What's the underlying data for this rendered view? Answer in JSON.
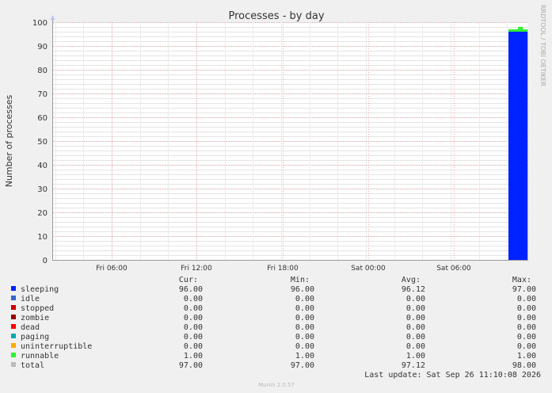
{
  "chart_data": {
    "type": "area",
    "title": "Processes - by day",
    "ylabel": "Number of processes",
    "xlabel": "",
    "ylim": [
      0,
      100
    ],
    "yticks": [
      0,
      10,
      20,
      30,
      40,
      50,
      60,
      70,
      80,
      90,
      100
    ],
    "x_tick_labels": [
      "Fri 06:00",
      "Fri 12:00",
      "Fri 18:00",
      "Sat 00:00",
      "Sat 06:00"
    ],
    "grid": true,
    "stacked": true,
    "series": [
      {
        "name": "sleeping",
        "color": "#0022ff",
        "values": [
          96,
          96,
          96,
          96
        ]
      },
      {
        "name": "idle",
        "color": "#3366cc",
        "values": [
          0,
          0,
          0,
          0
        ]
      },
      {
        "name": "stopped",
        "color": "#cc0000",
        "values": [
          0,
          0,
          0,
          0
        ]
      },
      {
        "name": "zombie",
        "color": "#990000",
        "values": [
          0,
          0,
          0,
          0
        ]
      },
      {
        "name": "dead",
        "color": "#ff0000",
        "values": [
          0,
          0,
          0,
          0
        ]
      },
      {
        "name": "paging",
        "color": "#00aaaa",
        "values": [
          0,
          0,
          0,
          0
        ]
      },
      {
        "name": "uninterruptible",
        "color": "#ffaa00",
        "values": [
          0,
          0,
          0,
          0
        ]
      },
      {
        "name": "runnable",
        "color": "#33ee33",
        "values": [
          1,
          1,
          2,
          1
        ]
      }
    ]
  },
  "legend": {
    "headers": [
      "Cur:",
      "Min:",
      "Avg:",
      "Max:"
    ],
    "rows": [
      {
        "name": "sleeping",
        "color": "#0022ff",
        "cur": "96.00",
        "min": "96.00",
        "avg": "96.12",
        "max": "97.00"
      },
      {
        "name": "idle",
        "color": "#3366cc",
        "cur": "0.00",
        "min": "0.00",
        "avg": "0.00",
        "max": "0.00"
      },
      {
        "name": "stopped",
        "color": "#cc0000",
        "cur": "0.00",
        "min": "0.00",
        "avg": "0.00",
        "max": "0.00"
      },
      {
        "name": "zombie",
        "color": "#990000",
        "cur": "0.00",
        "min": "0.00",
        "avg": "0.00",
        "max": "0.00"
      },
      {
        "name": "dead",
        "color": "#ff0000",
        "cur": "0.00",
        "min": "0.00",
        "avg": "0.00",
        "max": "0.00"
      },
      {
        "name": "paging",
        "color": "#00aaaa",
        "cur": "0.00",
        "min": "0.00",
        "avg": "0.00",
        "max": "0.00"
      },
      {
        "name": "uninterruptible",
        "color": "#ffaa00",
        "cur": "0.00",
        "min": "0.00",
        "avg": "0.00",
        "max": "0.00"
      },
      {
        "name": "runnable",
        "color": "#33ee33",
        "cur": "1.00",
        "min": "1.00",
        "avg": "1.00",
        "max": "1.00"
      },
      {
        "name": "total",
        "color": "#bbbbbb",
        "cur": "97.00",
        "min": "97.00",
        "avg": "97.12",
        "max": "98.00"
      }
    ]
  },
  "last_update": "Last update: Sat Sep 26 11:10:08 2026",
  "watermark": "RRDTOOL / TOBI OETIKER",
  "footer": "Munin 2.0.57"
}
